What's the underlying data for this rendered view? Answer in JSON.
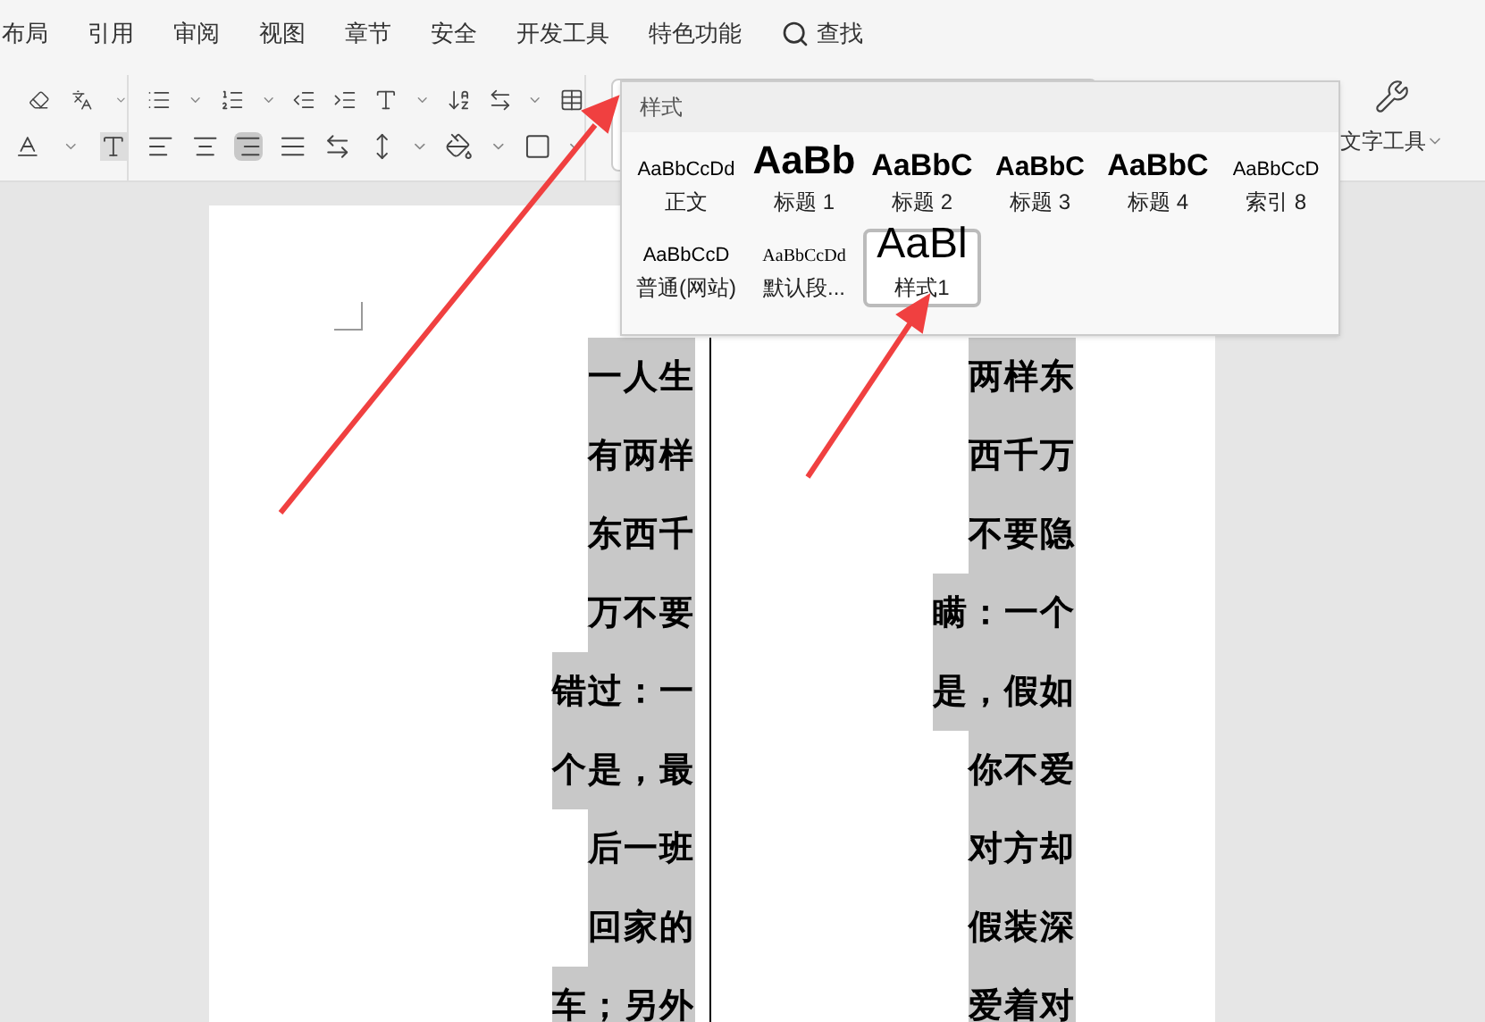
{
  "menu_tabs": [
    "布局",
    "引用",
    "审阅",
    "视图",
    "章节",
    "安全",
    "开发工具",
    "特色功能"
  ],
  "search": {
    "label": "查找"
  },
  "toolbar": {
    "text_tools": "文字工具"
  },
  "styles_panel": {
    "title": "样式",
    "styles": [
      {
        "sample": "AaBbCcDd",
        "label": "正文",
        "kind": "body",
        "selected": false
      },
      {
        "sample": "AaBb",
        "label": "标题 1",
        "kind": "h1",
        "selected": false
      },
      {
        "sample": "AaBbC",
        "label": "标题 2",
        "kind": "h2",
        "selected": false
      },
      {
        "sample": "AaBbC",
        "label": "标题 3",
        "kind": "h3",
        "selected": false
      },
      {
        "sample": "AaBbC",
        "label": "标题 4",
        "kind": "h4",
        "selected": false
      },
      {
        "sample": "AaBbCcD",
        "label": "索引 8",
        "kind": "index",
        "selected": false
      },
      {
        "sample": "AaBbCcD",
        "label": "普通(网站)",
        "kind": "web",
        "selected": false
      },
      {
        "sample": "AaBbCcDd",
        "label": "默认段...",
        "kind": "serif",
        "selected": false
      },
      {
        "sample": "AaBl",
        "label": "样式1",
        "kind": "large",
        "selected": true
      }
    ]
  },
  "document": {
    "columns": [
      [
        "一人生",
        "有两样",
        "东西千",
        "万不要",
        "错过：一",
        "个是，最",
        "后一班",
        "回家的",
        "车；另外"
      ],
      [
        "两样东",
        "西千万",
        "不要隐",
        "瞒：一个",
        "是，假如",
        "你不爱",
        "对方却",
        "假装深",
        "爱着对"
      ]
    ]
  }
}
